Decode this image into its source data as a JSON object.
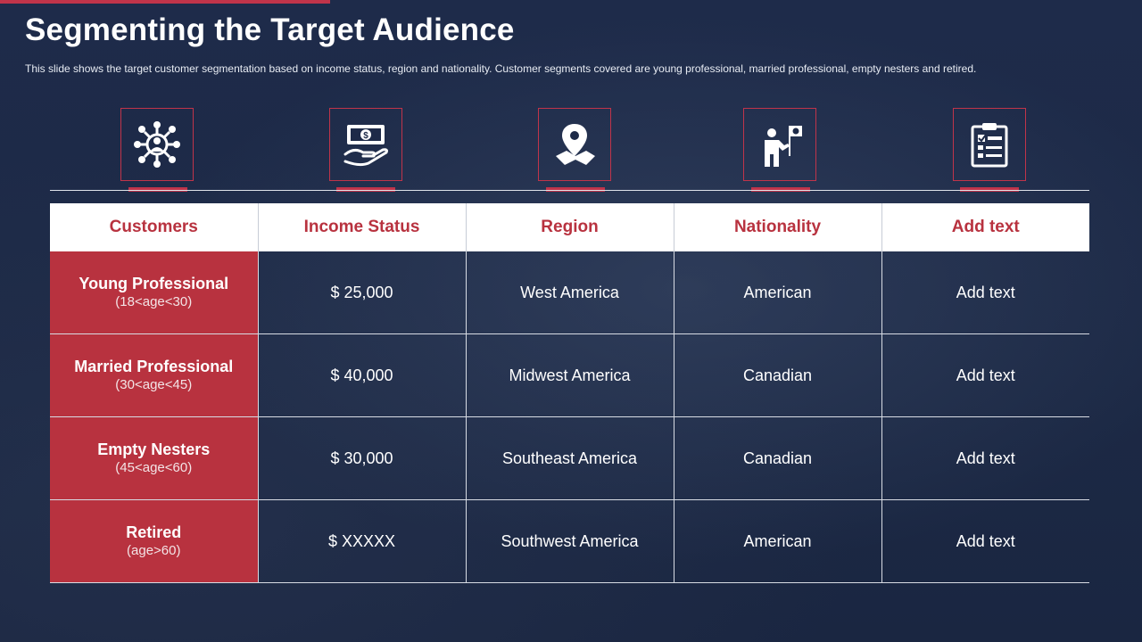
{
  "title": "Segmenting the Target Audience",
  "subtitle": "This slide shows the target customer segmentation based on income status, region and nationality. Customer segments covered  are young professional,  married professional,  empty nesters and retired.",
  "colors": {
    "accent": "#c0344a",
    "background": "#1d2a48",
    "header_text": "#b8323f"
  },
  "icons": [
    "network-people-icon",
    "money-hand-icon",
    "location-map-icon",
    "person-flag-icon",
    "clipboard-checklist-icon"
  ],
  "table": {
    "headers": [
      "Customers",
      "Income Status",
      "Region",
      "Nationality",
      "Add text"
    ],
    "rows": [
      {
        "segment": "Young Professional",
        "age": "(18<age<30)",
        "income": "$ 25,000",
        "region": "West America",
        "nationality": "American",
        "extra": "Add text"
      },
      {
        "segment": "Married Professional",
        "age": "(30<age<45)",
        "income": "$ 40,000",
        "region": "Midwest America",
        "nationality": "Canadian",
        "extra": "Add text"
      },
      {
        "segment": "Empty Nesters",
        "age": "(45<age<60)",
        "income": "$ 30,000",
        "region": "Southeast America",
        "nationality": "Canadian",
        "extra": "Add text"
      },
      {
        "segment": "Retired",
        "age": "(age>60)",
        "income": "$ XXXXX",
        "region": "Southwest America",
        "nationality": "American",
        "extra": "Add text"
      }
    ]
  }
}
